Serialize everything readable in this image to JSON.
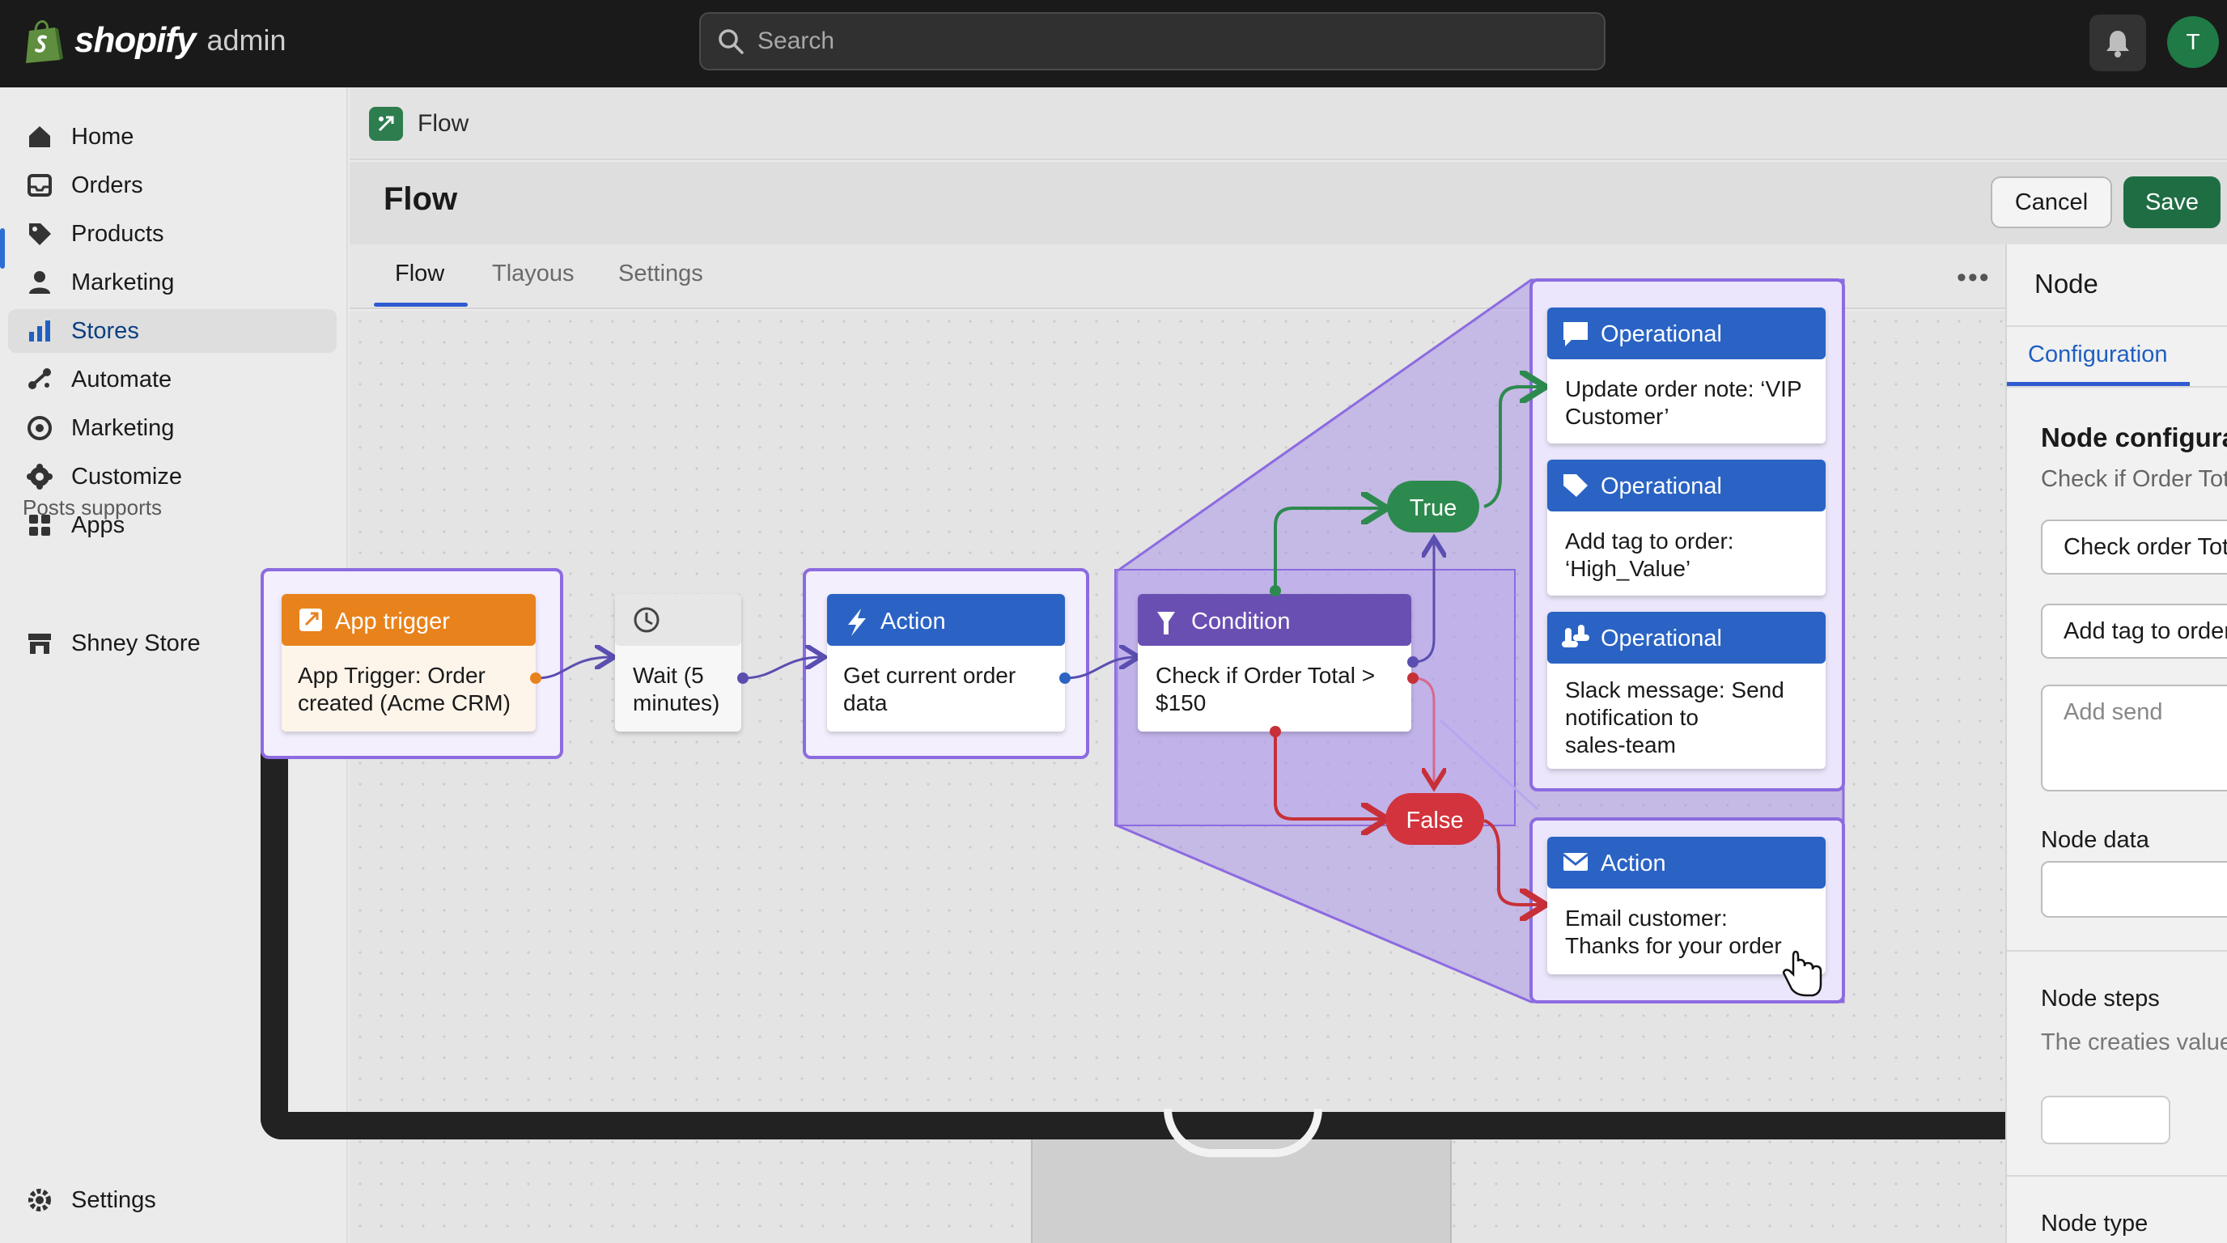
{
  "brand": {
    "name": "shopify",
    "suffix": "admin"
  },
  "search": {
    "placeholder": "Search"
  },
  "user": {
    "avatar_initial": "T"
  },
  "sidebar": {
    "items": [
      {
        "label": "Home",
        "icon": "home-icon"
      },
      {
        "label": "Orders",
        "icon": "inbox-icon"
      },
      {
        "label": "Products",
        "icon": "tag-icon"
      },
      {
        "label": "Marketing",
        "icon": "person-icon"
      },
      {
        "label": "Stores",
        "icon": "bar-chart-icon",
        "active": true
      },
      {
        "label": "Automate",
        "icon": "automate-icon"
      },
      {
        "label": "Marketing",
        "icon": "target-icon"
      },
      {
        "label": "Customize",
        "icon": "gear-flower-icon"
      },
      {
        "label": "Apps",
        "icon": "grid-icon"
      }
    ],
    "section_title": "Posts supports",
    "store": {
      "label": "Shney Store",
      "icon": "store-icon"
    },
    "settings_label": "Settings"
  },
  "breadcrumb": {
    "app": "Flow"
  },
  "page": {
    "title": "Flow",
    "cancel_label": "Cancel",
    "save_label": "Save"
  },
  "tabs": [
    {
      "label": "Flow",
      "active": true
    },
    {
      "label": "Tlayous"
    },
    {
      "label": "Settings"
    }
  ],
  "flow": {
    "trigger": {
      "header": "App trigger",
      "line1": "App Trigger: Order",
      "line2": "created (Acme CRM)"
    },
    "wait": {
      "line1": "Wait (5",
      "line2": "minutes)"
    },
    "action1": {
      "header": "Action",
      "line1": "Get current order",
      "line2": "data"
    },
    "condition": {
      "header": "Condition",
      "line1": "Check if Order Total >",
      "line2": "$150"
    },
    "branch_true": "True",
    "branch_false": "False",
    "op1": {
      "header": "Operational",
      "line1": "Update order note: ‘VIP",
      "line2": "Customer’"
    },
    "op2": {
      "header": "Operational",
      "line1": "Add tag to order:",
      "line2": "‘High_Value’"
    },
    "op3": {
      "header": "Operational",
      "line1": "Slack message: Send",
      "line2": "notification to",
      "line3": "sales-team"
    },
    "email": {
      "header": "Action",
      "line1": "Email customer:",
      "line2": "Thanks for your order"
    }
  },
  "panel": {
    "title": "Node",
    "tab": "Configuration",
    "config_title": "Node configurat",
    "config_sub": "Check if Order Tot",
    "field1": "Check order Tot",
    "field2": "Add tag to order",
    "field3_placeholder": "Add send",
    "data_label": "Node data",
    "steps_label": "Node steps",
    "steps_sub": "The creaties value",
    "type_label": "Node type"
  },
  "colors": {
    "topbar": "#1a1a1a",
    "trigger": "#e8821f",
    "action": "#2c64c4",
    "condition": "#6a4fb3",
    "true": "#2d8a4e",
    "false": "#d3333c",
    "highlight": "#8c6be0",
    "save": "#1f6e43"
  }
}
